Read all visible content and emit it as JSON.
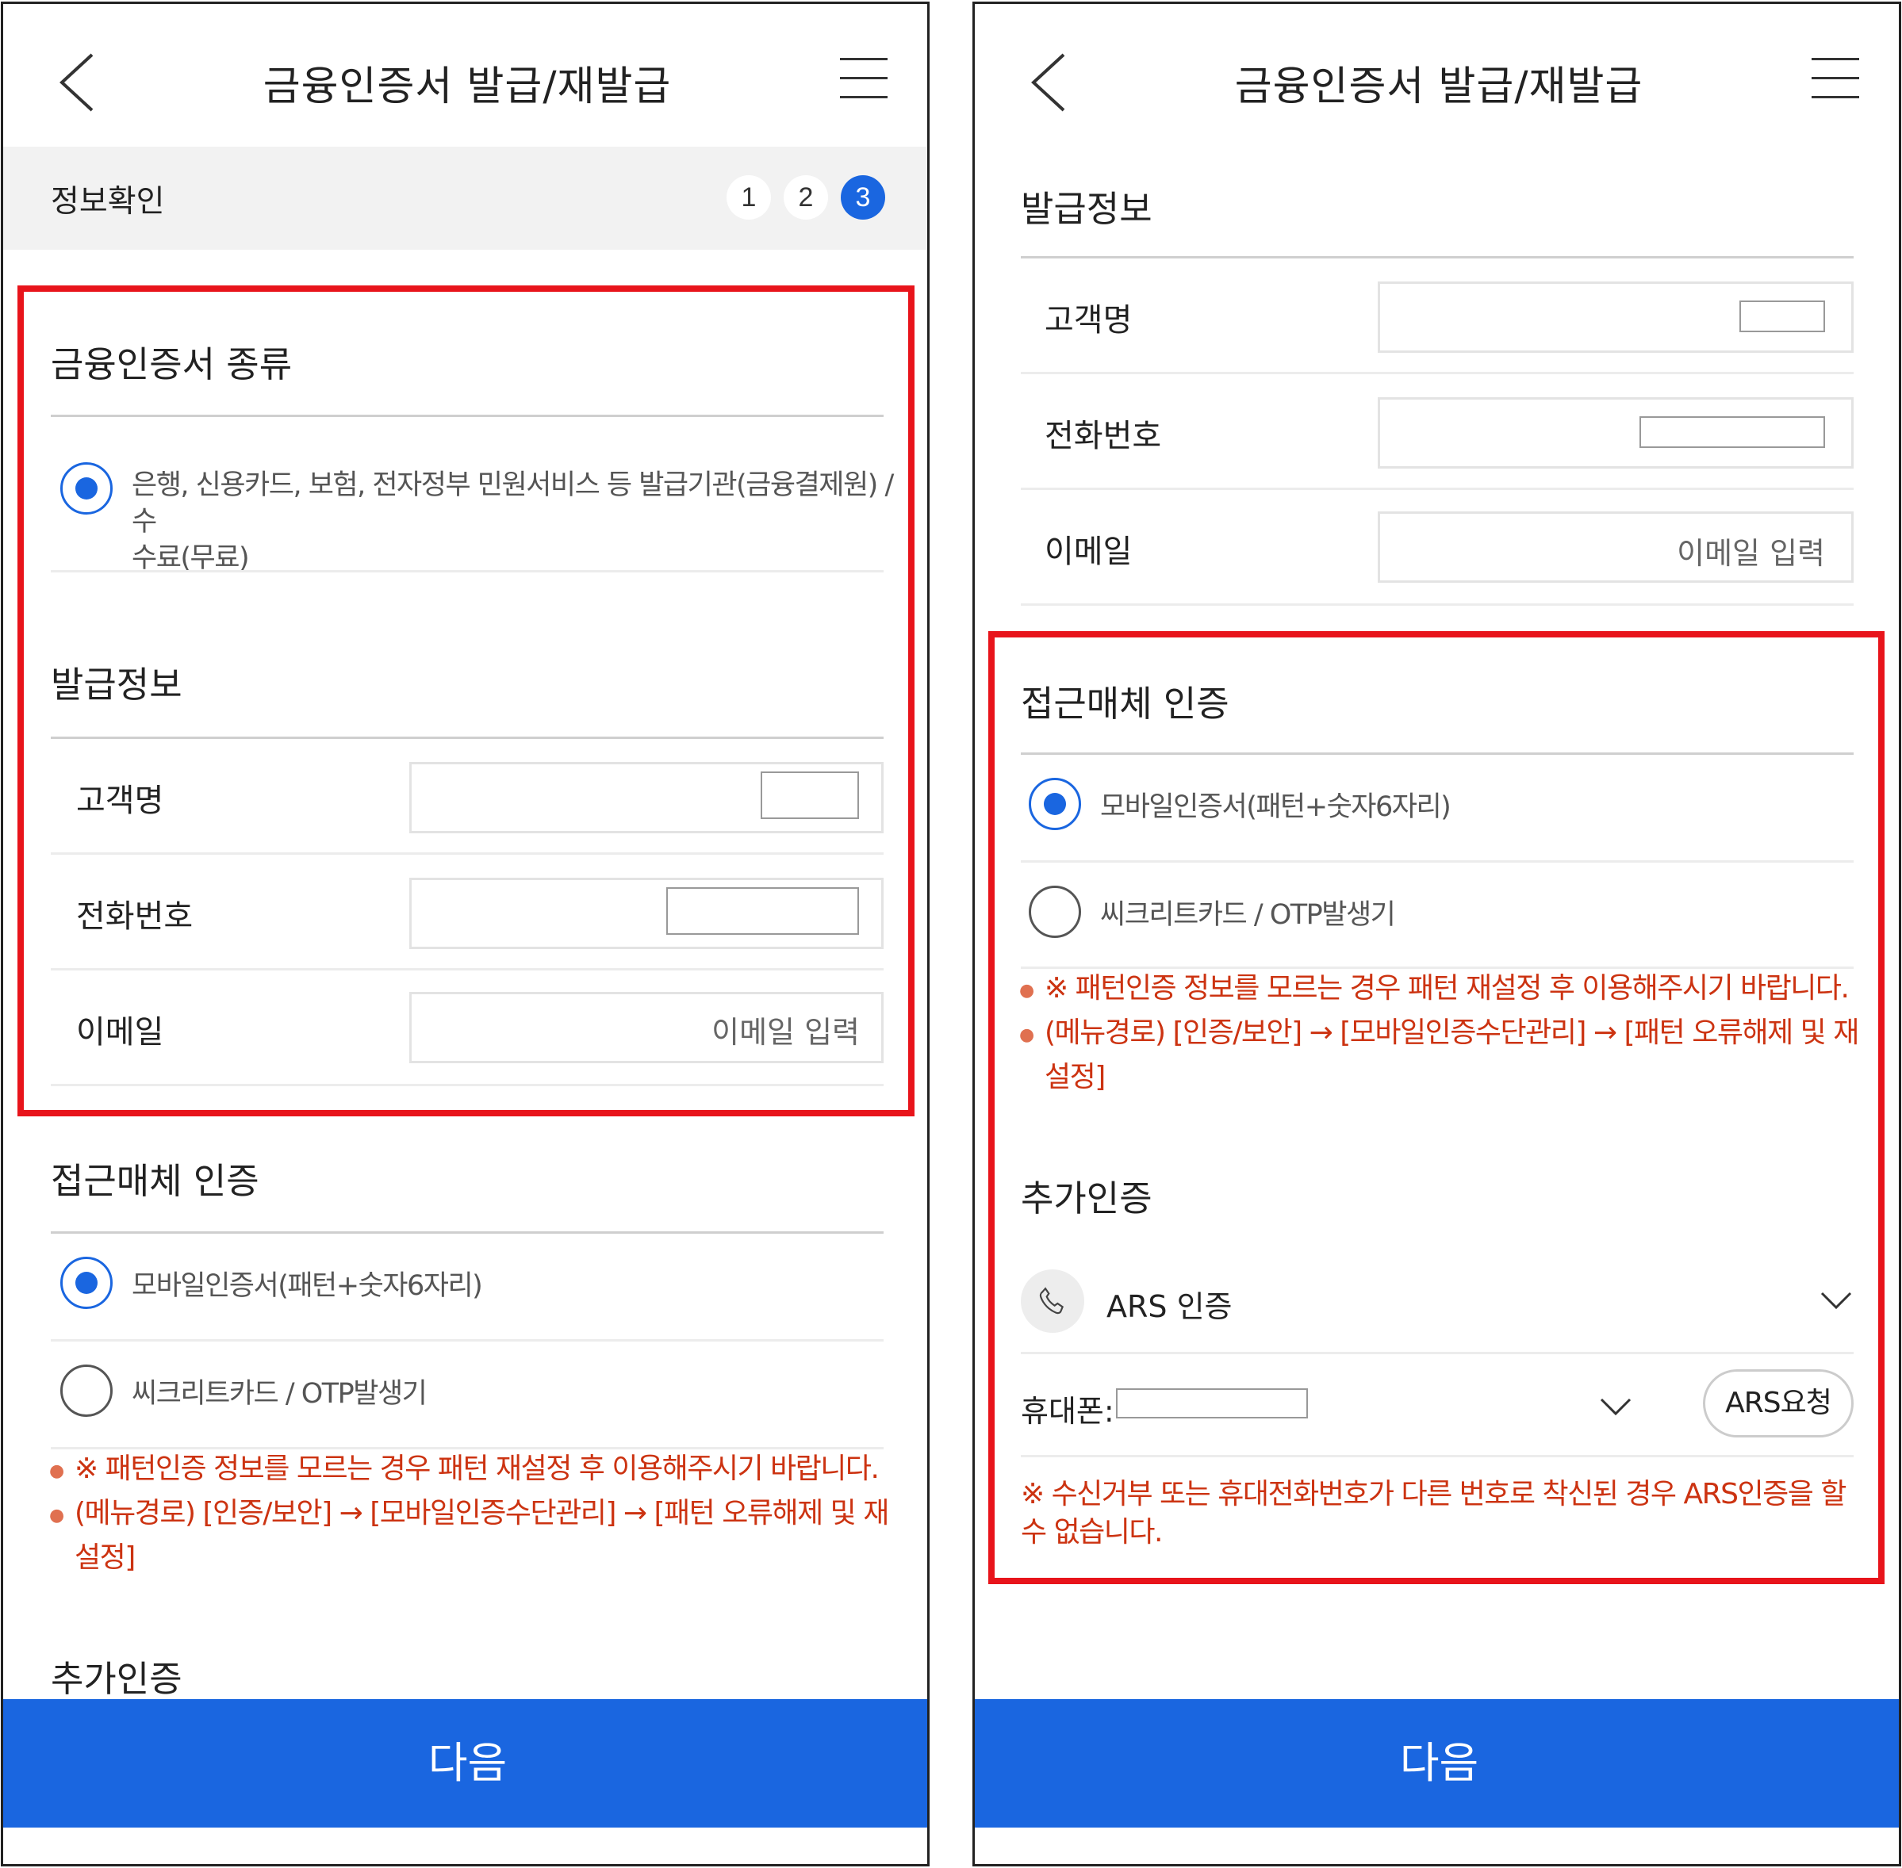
{
  "screen": {
    "title": "금융인증서 발급/재발급",
    "next_label": "다음"
  },
  "steps": {
    "label": "정보확인",
    "items": [
      "1",
      "2",
      "3"
    ],
    "current": "3"
  },
  "cert_type": {
    "title": "금융인증서 종류",
    "option_line1": "은행, 신용카드, 보험, 전자정부 민원서비스 등 발급기관(금융결제원) / 수",
    "option_line2": "수료(무료)"
  },
  "issue_info": {
    "title": "발급정보",
    "name_label": "고객명",
    "phone_label": "전화번호",
    "email_label": "이메일",
    "email_placeholder": "이메일 입력"
  },
  "access_auth": {
    "title": "접근매체 인증",
    "option_mobile": "모바일인증서(패턴+숫자6자리)",
    "option_secret": "씨크리트카드 / OTP발생기",
    "notice1": "※ 패턴인증 정보를 모르는 경우 패턴 재설정 후 이용해주시기 바랍니다.",
    "notice2_line1": "(메뉴경로) [인증/보안] → [모바일인증수단관리] → [패턴 오류해제 및 재",
    "notice2_line2": "설정]"
  },
  "extra_auth": {
    "title": "추가인증",
    "method": "ARS 인증",
    "phone_label": "휴대폰:",
    "request_button": "ARS요청",
    "notice_line1": "※ 수신거부 또는 휴대전화번호가 다른 번호로 착신된 경우 ARS인증을 할",
    "notice_line2": "수 없습니다."
  },
  "colors": {
    "accent": "#1a66e0",
    "warning": "#cc3311",
    "highlight": "#e8141b"
  }
}
